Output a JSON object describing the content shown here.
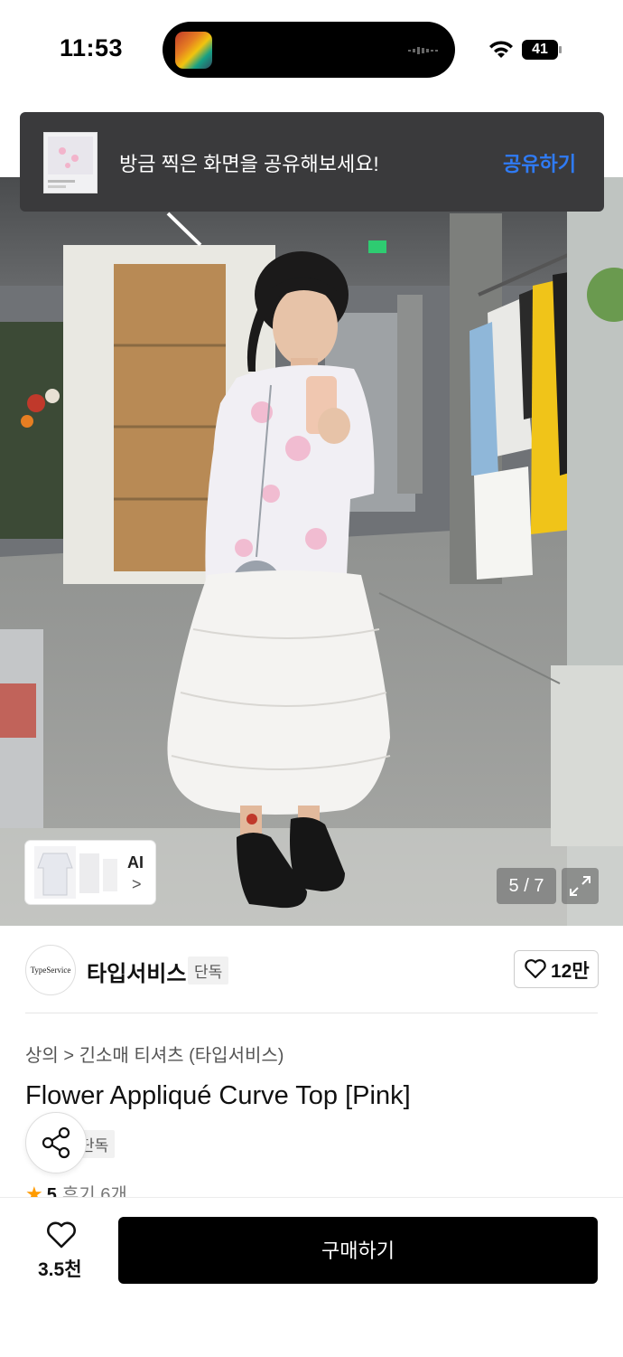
{
  "status_bar": {
    "time": "11:53",
    "battery": "41"
  },
  "toast": {
    "message": "방금 찍은 화면을 공유해보세요!",
    "action": "공유하기"
  },
  "gallery": {
    "ai_label": "AI",
    "ai_arrow": ">",
    "counter": "5 / 7"
  },
  "seller": {
    "logo_text": "TypeService",
    "name": "타입서비스",
    "badge": "단독",
    "like_count": "12만"
  },
  "product": {
    "breadcrumb": "상의 > 긴소매 티셔츠 (타입서비스)",
    "title": "Flower Appliqué Curve Top [Pink]",
    "badge_visible": "단독",
    "rating": "5",
    "reviews": "후기 6개"
  },
  "bottom_bar": {
    "wish_count": "3.5천",
    "buy_label": "구매하기"
  },
  "colors": {
    "accent": "#2f7bf5",
    "star": "#ff9b00",
    "buy_button": "#000000"
  },
  "icons": [
    "wifi-icon",
    "battery-icon",
    "heart-icon",
    "share-icon",
    "chevron-right-icon",
    "expand-icon",
    "star-icon"
  ]
}
